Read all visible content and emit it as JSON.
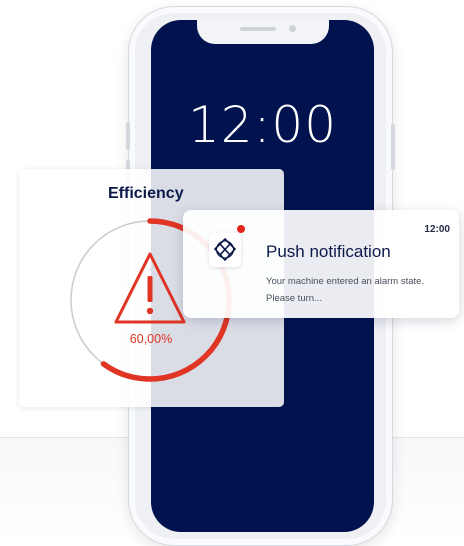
{
  "lock_screen": {
    "time": "12:00"
  },
  "efficiency_card": {
    "title": "Efficiency",
    "value_label": "60,00%",
    "fraction": 0.6,
    "warning_icon": "warning-triangle-icon",
    "accent_color": "#e03524"
  },
  "push_notification": {
    "title": "Push notification",
    "time": "12:00",
    "body_line_1": "Your machine entered an alarm state.",
    "body_line_2": "Please turn...",
    "app_icon": "app-logo-icon",
    "badge_color": "#e5241e"
  },
  "colors": {
    "screen": "#00134f",
    "title": "#0b1a4a"
  }
}
